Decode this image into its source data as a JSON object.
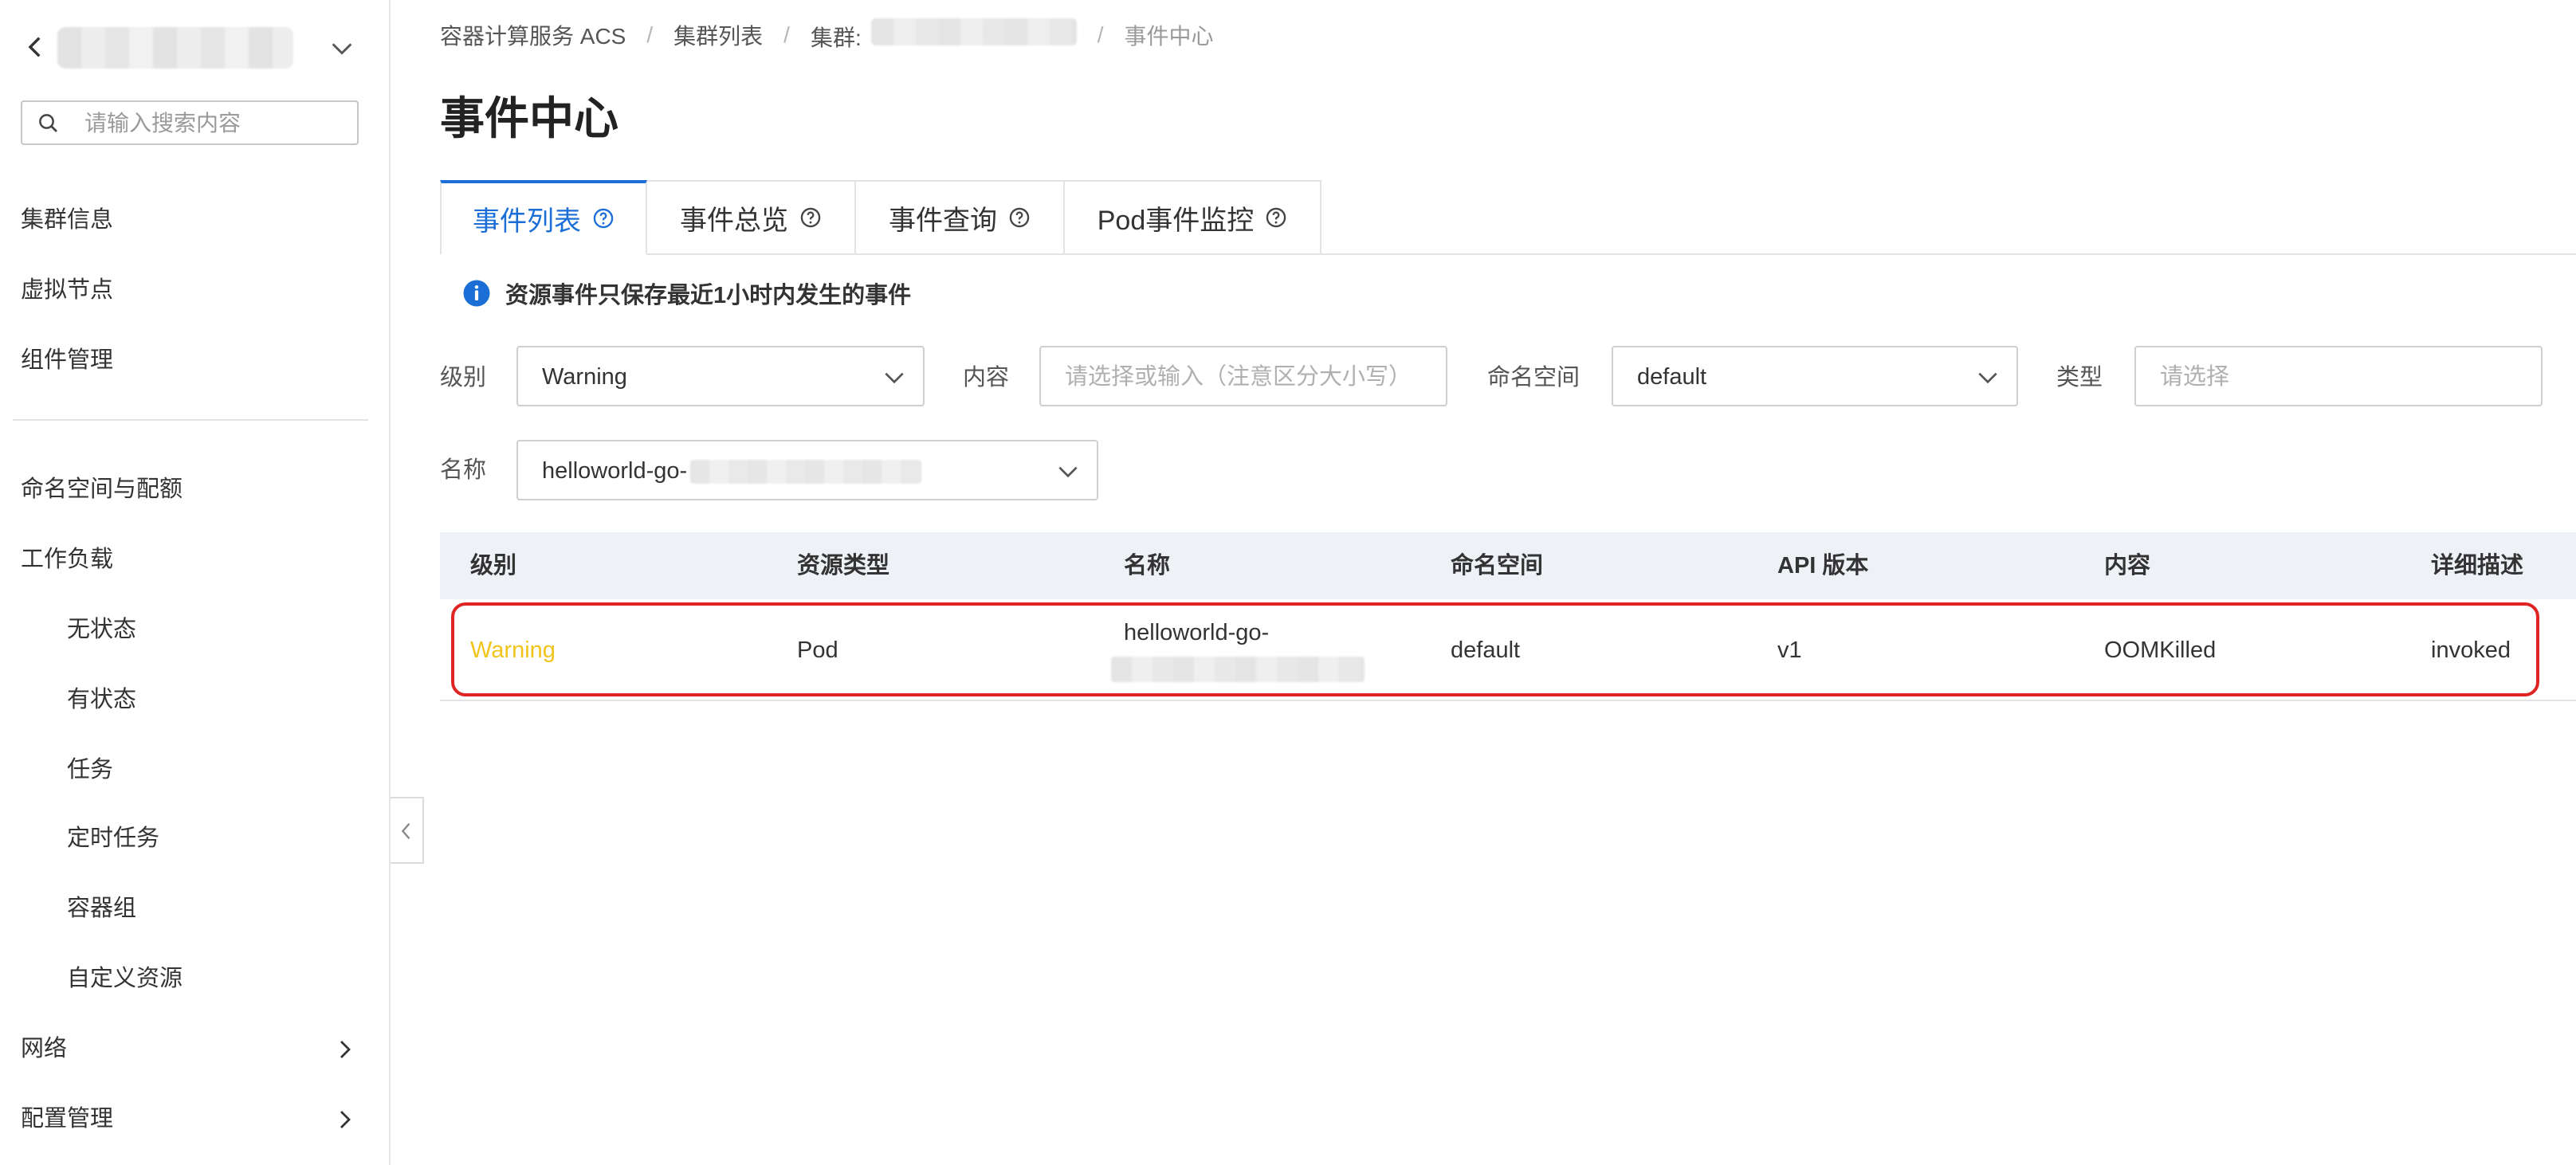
{
  "sidebar": {
    "search_placeholder": "请输入搜索内容",
    "items": [
      {
        "label": "集群信息"
      },
      {
        "label": "虚拟节点"
      },
      {
        "label": "组件管理"
      },
      {
        "label": "命名空间与配额"
      },
      {
        "label": "工作负载"
      },
      {
        "label": "无状态"
      },
      {
        "label": "有状态"
      },
      {
        "label": "任务"
      },
      {
        "label": "定时任务"
      },
      {
        "label": "容器组"
      },
      {
        "label": "自定义资源"
      },
      {
        "label": "网络"
      },
      {
        "label": "配置管理"
      }
    ]
  },
  "breadcrumb": {
    "service": "容器计算服务 ACS",
    "cluster_list": "集群列表",
    "cluster_prefix": "集群:",
    "current": "事件中心",
    "separator": "/"
  },
  "page": {
    "title": "事件中心"
  },
  "tabs": [
    {
      "label": "事件列表",
      "active": true
    },
    {
      "label": "事件总览"
    },
    {
      "label": "事件查询"
    },
    {
      "label": "Pod事件监控"
    }
  ],
  "notice": "资源事件只保存最近1小时内发生的事件",
  "filters": {
    "level": {
      "label": "级别",
      "value": "Warning"
    },
    "content": {
      "label": "内容",
      "placeholder": "请选择或输入（注意区分大小写）"
    },
    "namespace": {
      "label": "命名空间",
      "value": "default"
    },
    "type": {
      "label": "类型",
      "placeholder": "请选择"
    },
    "name": {
      "label": "名称",
      "value": "helloworld-go-"
    }
  },
  "table": {
    "headers": [
      "级别",
      "资源类型",
      "名称",
      "命名空间",
      "API 版本",
      "内容",
      "详细描述"
    ],
    "rows": [
      {
        "level": "Warning",
        "resource_type": "Pod",
        "name": "helloworld-go-",
        "namespace": "default",
        "api_version": "v1",
        "content": "OOMKilled",
        "detail": "invoked"
      }
    ]
  },
  "colors": {
    "accent": "#1b6ed6",
    "warning": "#f0c419",
    "highlight": "#e02424"
  }
}
